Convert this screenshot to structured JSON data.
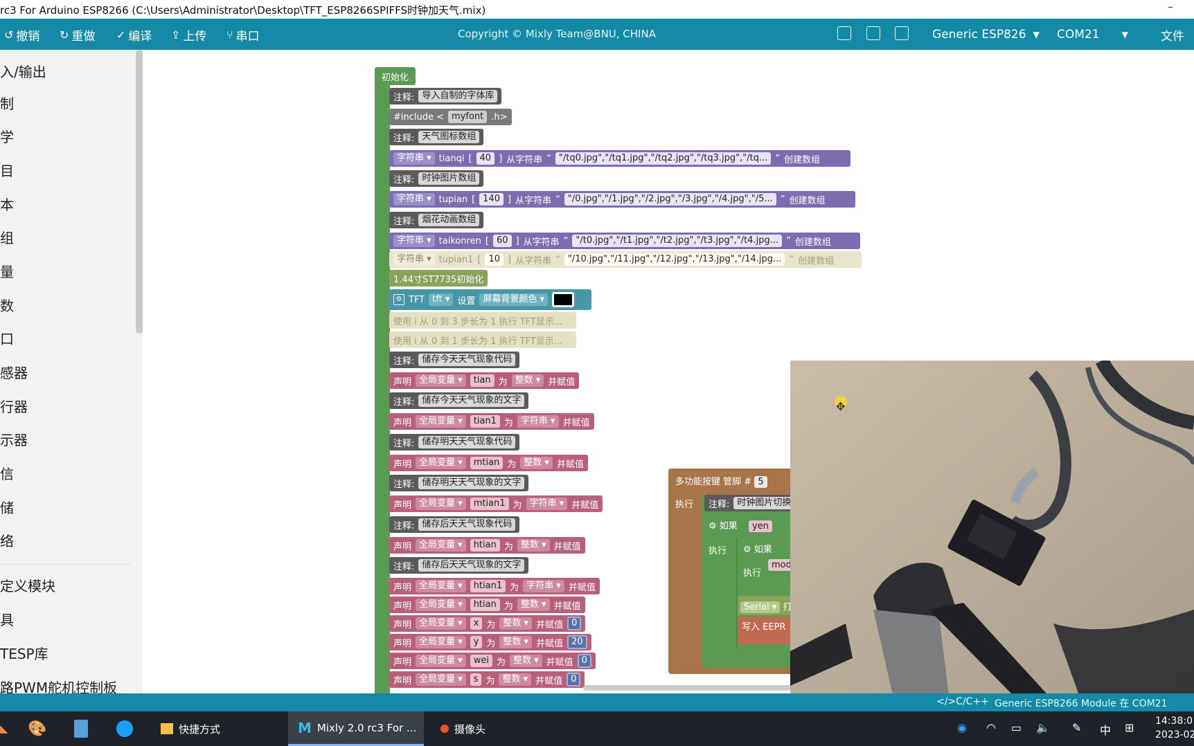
{
  "window": {
    "title": "rc3 For Arduino ESP8266 (C:\\Users\\Administrator\\Desktop\\TFT_ESP8266SPIFFS时钟加天气.mix)",
    "minimize": "–"
  },
  "toolbar": {
    "undo": "撤销",
    "redo": "重做",
    "compile": "编译",
    "upload": "上传",
    "serial": "串口",
    "copyright": "Copyright © Mixly Team@BNU, CHINA",
    "board": "Generic ESP826",
    "port": "COM21",
    "file_menu": "文件"
  },
  "sidebar": {
    "categories": [
      "入/输出",
      "制",
      "学",
      "目",
      "本",
      "组",
      "量",
      "数",
      "口",
      "感器",
      "行器",
      "示器",
      "信",
      "储",
      "络",
      "定义模块",
      "具",
      "TESP库",
      "路PWM舵机控制板"
    ]
  },
  "blocks": {
    "init_label": "初始化",
    "note_label": "注释:",
    "notes": {
      "font": "导入自制的字体库",
      "weather_icons": "天气图标数组",
      "clock_imgs": "时钟图片数组",
      "fireworks": "烟花动画数组",
      "today_code": "储存今天天气现象代码",
      "today_text": "储存今天天气现象的文字",
      "tomorrow_code": "储存明天天气现象代码",
      "tomorrow_text": "储存明天天气现象的文字",
      "after_code": "储存后天天气现象代码",
      "after_text": "储存后天天气现象的文字"
    },
    "include": {
      "prefix": "#include <",
      "name": "myfont",
      "suffix": ".h>"
    },
    "str_type": "字符串",
    "from_string": "从字符串",
    "create_array": "创建数组",
    "open_quote": "“",
    "close_quote": "”",
    "arrays": [
      {
        "name": "tianqi",
        "size": "40",
        "value": "\"/tq0.jpg\",\"/tq1.jpg\",\"/tq2.jpg\",\"/tq3.jpg\",\"/tq..."
      },
      {
        "name": "tupian",
        "size": "140",
        "value": "\"/0.jpg\",\"/1.jpg\",\"/2.jpg\",\"/3.jpg\",\"/4.jpg\",\"/5..."
      },
      {
        "name": "taikonren",
        "size": "60",
        "value": "\"/t0.jpg\",\"/t1.jpg\",\"/t2.jpg\",\"/t3.jpg\",\"/t4.jpg..."
      },
      {
        "name": "tupian1",
        "size": "10",
        "value": "\"/10.jpg\",\"/11.jpg\",\"/12.jpg\",\"/13.jpg\",\"/14.jpg..."
      }
    ],
    "st7735_init": "1.44寸ST7735初始化",
    "tft": {
      "label": "TFT",
      "name": "tft",
      "set": "设置",
      "prop": "屏幕背景颜色",
      "color": "#000000"
    },
    "loops": [
      "使用 i 从 0 到 3 步长为 1 执行 TFT显示...",
      "使用 i 从 0 到 1 步长为 1 执行 TFT显示..."
    ],
    "declare": "声明",
    "scope": "全局变量",
    "as": "为",
    "assign": "并赋值",
    "int_type": "整数",
    "decls": [
      {
        "name": "tian",
        "type": "整数",
        "value": ""
      },
      {
        "name": "tian1",
        "type": "字符串",
        "value": ""
      },
      {
        "name": "mtian",
        "type": "整数",
        "value": ""
      },
      {
        "name": "mtian1",
        "type": "字符串",
        "value": ""
      },
      {
        "name": "htian",
        "type": "整数",
        "value": ""
      },
      {
        "name": "htian1",
        "type": "字符串",
        "value": ""
      },
      {
        "name": "htian",
        "type": "整数",
        "value": ""
      },
      {
        "name": "x",
        "type": "整数",
        "value": "0"
      },
      {
        "name": "y",
        "type": "整数",
        "value": "20"
      },
      {
        "name": "wei",
        "type": "整数",
        "value": "0"
      },
      {
        "name": "s",
        "type": "整数",
        "value": "0"
      }
    ],
    "button_block": {
      "title": "多功能按键 管脚 #",
      "pin": "5",
      "exec": "执行",
      "note": "时钟图片切换",
      "if": "如果",
      "var_yen": "yen",
      "var_mod": "mod",
      "serial": "Serial",
      "print": "打",
      "write": "写入",
      "eeprom": "EEPR"
    }
  },
  "statusbar": {
    "lang": "</>C/C++",
    "board_status": "Generic ESP8266 Module 在 COM21"
  },
  "taskbar": {
    "shortcut": "快捷方式",
    "mixly": "Mixly 2.0 rc3 For ...",
    "camera": "摄像头",
    "ime": "中",
    "time": "14:38:0",
    "date": "2023-02"
  }
}
